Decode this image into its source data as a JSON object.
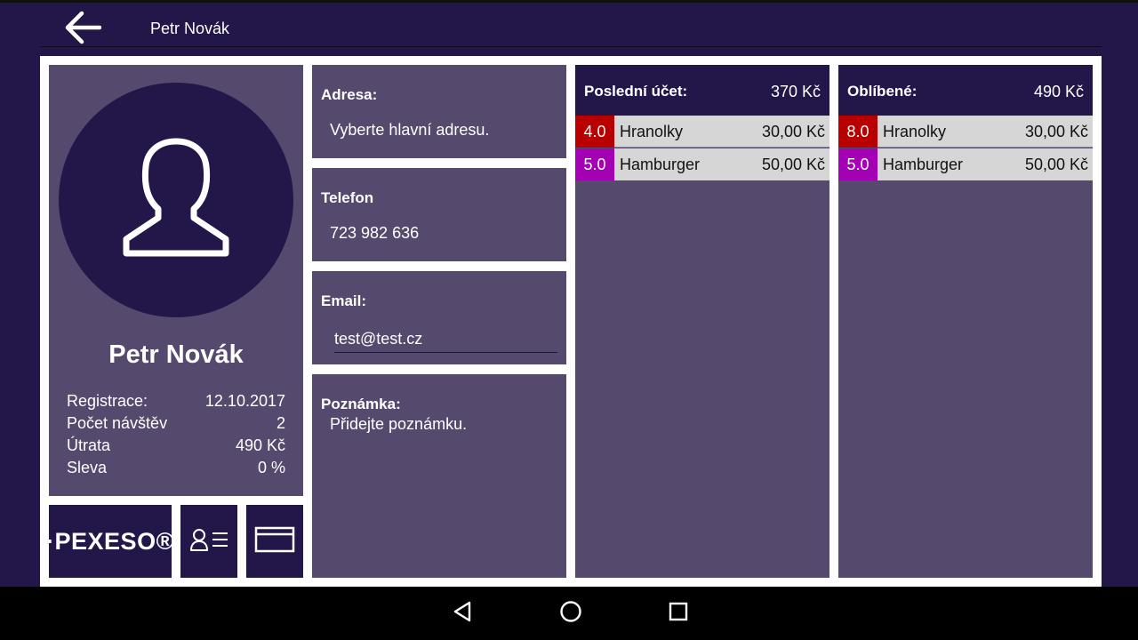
{
  "appbar": {
    "title": "Petr Novák"
  },
  "profile": {
    "name": "Petr Novák",
    "stats": [
      {
        "label": "Registrace:",
        "value": "12.10.2017"
      },
      {
        "label": "Počet návštěv",
        "value": "2"
      },
      {
        "label": "Útrata",
        "value": "490 Kč"
      },
      {
        "label": "Sleva",
        "value": "0 %"
      }
    ]
  },
  "tiles": {
    "logo": "·PEXESO®"
  },
  "info": {
    "address": {
      "label": "Adresa:",
      "value": "Vyberte hlavní adresu."
    },
    "phone": {
      "label": "Telefon",
      "value": "723 982 636"
    },
    "email": {
      "label": "Email:",
      "value": "test@test.cz"
    },
    "note": {
      "label": "Poznámka:",
      "value": "Přidejte poznámku."
    }
  },
  "last_bill": {
    "title": "Poslední účet:",
    "total": "370 Kč",
    "items": [
      {
        "qty": "4.0",
        "name": "Hranolky",
        "price": "30,00 Kč",
        "qty_color": "#b80000"
      },
      {
        "qty": "5.0",
        "name": "Hamburger",
        "price": "50,00 Kč",
        "qty_color": "#a400b4"
      }
    ]
  },
  "favorites": {
    "title": "Oblíbené:",
    "total": "490 Kč",
    "items": [
      {
        "qty": "8.0",
        "name": "Hranolky",
        "price": "30,00 Kč",
        "qty_color": "#b80000"
      },
      {
        "qty": "5.0",
        "name": "Hamburger",
        "price": "50,00 Kč",
        "qty_color": "#a400b4"
      }
    ]
  },
  "icons": {
    "back": "arrow-left-icon",
    "avatar": "person-outline-icon",
    "contact_list": "contact-list-icon",
    "card": "credit-card-icon",
    "nav_back": "triangle-back-icon",
    "nav_home": "circle-home-icon",
    "nav_recents": "square-recents-icon"
  },
  "colors": {
    "dark_purple": "#231749",
    "panel_purple": "#554a6d",
    "row_gray": "#d6d6d6",
    "qty_red": "#b80000",
    "qty_magenta": "#a400b4"
  }
}
